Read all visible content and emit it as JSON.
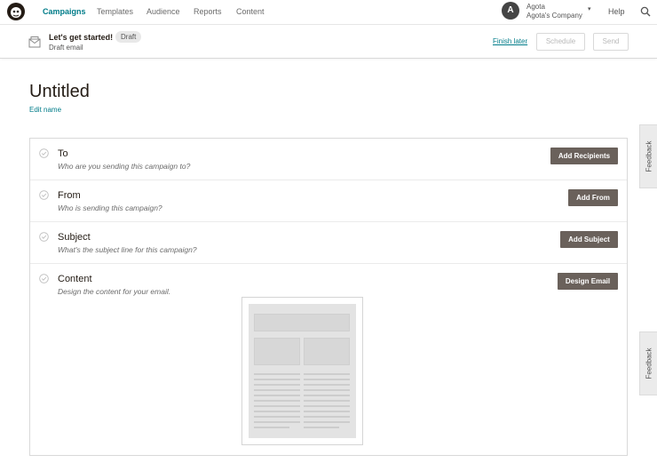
{
  "nav": {
    "items": [
      {
        "label": "Campaigns",
        "active": true
      },
      {
        "label": "Templates"
      },
      {
        "label": "Audience"
      },
      {
        "label": "Reports"
      },
      {
        "label": "Content"
      }
    ],
    "user": {
      "initial": "A",
      "name": "Agota",
      "company": "Agota's Company"
    },
    "help_label": "Help",
    "icons": {
      "logo": "mailchimp-logo",
      "search": "search-icon",
      "caret": "chevron-down-icon"
    }
  },
  "status": {
    "title": "Let's get started!",
    "badge": "Draft",
    "subtitle": "Draft email",
    "finish_later": "Finish later",
    "schedule_label": "Schedule",
    "send_label": "Send"
  },
  "campaign": {
    "title": "Untitled",
    "edit_name": "Edit name"
  },
  "checklist": [
    {
      "title": "To",
      "subtitle": "Who are you sending this campaign to?",
      "button": "Add Recipients"
    },
    {
      "title": "From",
      "subtitle": "Who is sending this campaign?",
      "button": "Add From"
    },
    {
      "title": "Subject",
      "subtitle": "What's the subject line for this campaign?",
      "button": "Add Subject"
    },
    {
      "title": "Content",
      "subtitle": "Design the content for your email.",
      "button": "Design Email"
    }
  ],
  "feedback_label": "Feedback",
  "colors": {
    "accent": "#007c89",
    "dark_button": "#6a615b",
    "text": "#241c15"
  }
}
